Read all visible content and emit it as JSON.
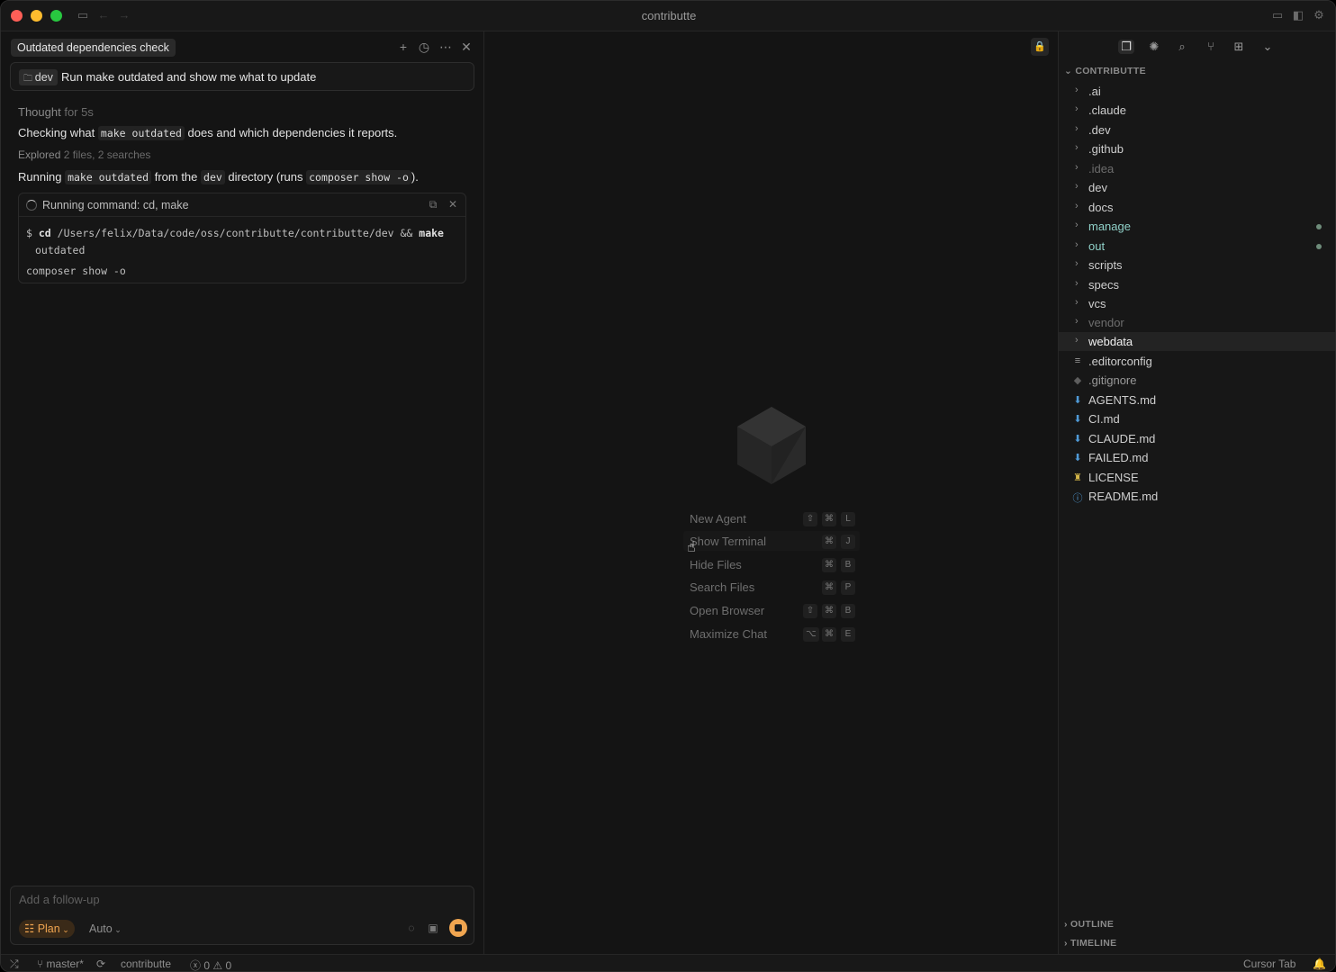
{
  "window": {
    "title": "contributte"
  },
  "chat": {
    "tab_title": "Outdated dependencies check",
    "prompt": {
      "folder": "dev",
      "text": "Run make outdated and show me what to update"
    },
    "thought": {
      "label": "Thought",
      "duration": "for 5s"
    },
    "checking": {
      "pre": "Checking what",
      "code": "make outdated",
      "post": "does and which dependencies it reports."
    },
    "explored": {
      "label": "Explored",
      "detail": "2 files, 2 searches"
    },
    "running": {
      "pre": "Running",
      "code1": "make outdated",
      "mid1": "from the",
      "code2": "dev",
      "mid2": "directory (runs",
      "code3": "composer show -o",
      "post": ")."
    },
    "command": {
      "title": "Running command: cd, make",
      "prompt_symbol": "$",
      "cd": "cd",
      "path": "/Users/felix/Data/code/oss/contributte/contributte/dev",
      "and": "&&",
      "make": "make",
      "target": "outdated",
      "output": "composer show -o"
    },
    "followup": {
      "placeholder": "Add a follow-up",
      "mode": "Plan",
      "model": "Auto"
    }
  },
  "center": {
    "shortcuts": [
      {
        "label": "New Agent",
        "keys": [
          "⇧",
          "⌘",
          "L"
        ]
      },
      {
        "label": "Show Terminal",
        "keys": [
          "⌘",
          "J"
        ]
      },
      {
        "label": "Hide Files",
        "keys": [
          "⌘",
          "B"
        ]
      },
      {
        "label": "Search Files",
        "keys": [
          "⌘",
          "P"
        ]
      },
      {
        "label": "Open Browser",
        "keys": [
          "⇧",
          "⌘",
          "B"
        ]
      },
      {
        "label": "Maximize Chat",
        "keys": [
          "⌥",
          "⌘",
          "E"
        ]
      }
    ]
  },
  "explorer": {
    "root": "CONTRIBUTTE",
    "folders": [
      ".ai",
      ".claude",
      ".dev",
      ".github",
      ".idea",
      "dev",
      "docs",
      "manage",
      "out",
      "scripts",
      "specs",
      "vcs",
      "vendor",
      "webdata"
    ],
    "files": [
      ".editorconfig",
      ".gitignore",
      "AGENTS.md",
      "CI.md",
      "CLAUDE.md",
      "FAILED.md",
      "LICENSE",
      "README.md"
    ],
    "outline": "OUTLINE",
    "timeline": "TIMELINE",
    "colors": {
      "modified": "#8fd0c8",
      "ignored": "#6d6d6d",
      "markdown": "#4f9ad6",
      "accent": "#f0a550"
    }
  },
  "statusbar": {
    "branch": "master*",
    "project": "contributte",
    "errors": "0",
    "warnings": "0",
    "right": "Cursor Tab"
  }
}
